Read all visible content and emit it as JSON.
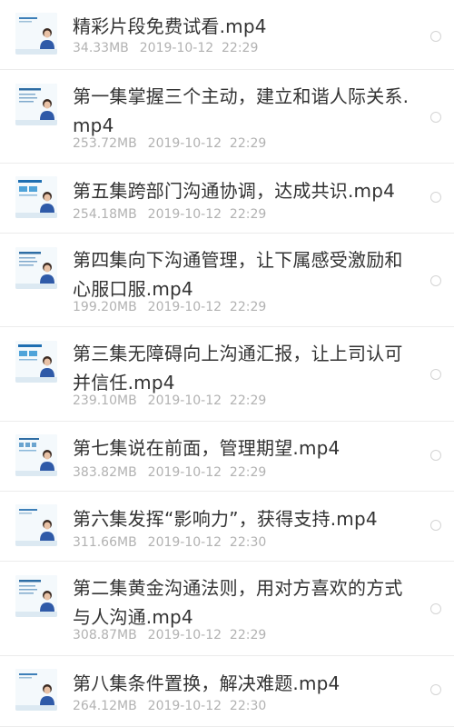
{
  "files": [
    {
      "name": "精彩片段免费试看.mp4",
      "size": "34.33MB",
      "date": "2019-10-12  22:29",
      "thumb_variant": "a"
    },
    {
      "name": "第一集掌握三个主动，建立和谐人际关系.mp4",
      "size": "253.72MB",
      "date": "2019-10-12  22:29",
      "thumb_variant": "b"
    },
    {
      "name": "第五集跨部门沟通协调，达成共识.mp4",
      "size": "254.18MB",
      "date": "2019-10-12  22:29",
      "thumb_variant": "c"
    },
    {
      "name": "第四集向下沟通管理，让下属感受激励和心服口服.mp4",
      "size": "199.20MB",
      "date": "2019-10-12  22:29",
      "thumb_variant": "b"
    },
    {
      "name": "第三集无障碍向上沟通汇报，让上司认可并信任.mp4",
      "size": "239.10MB",
      "date": "2019-10-12  22:29",
      "thumb_variant": "c"
    },
    {
      "name": "第七集说在前面，管理期望.mp4",
      "size": "383.82MB",
      "date": "2019-10-12  22:29",
      "thumb_variant": "d"
    },
    {
      "name": "第六集发挥“影响力”，获得支持.mp4",
      "size": "311.66MB",
      "date": "2019-10-12  22:30",
      "thumb_variant": "a"
    },
    {
      "name": "第二集黄金沟通法则，用对方喜欢的方式与人沟通.mp4",
      "size": "308.87MB",
      "date": "2019-10-12  22:29",
      "thumb_variant": "b"
    },
    {
      "name": "第八集条件置换，解决难题.mp4",
      "size": "264.12MB",
      "date": "2019-10-12  22:30",
      "thumb_variant": "a"
    }
  ],
  "colors": {
    "title_text": "#333333",
    "meta_text": "#b2b2b2",
    "divider": "#ececec",
    "radio_border": "#d4d4d4",
    "thumb_background": "#eef6fb"
  },
  "icons": {
    "thumbnail": "video-thumbnail-icon",
    "select": "radio-circle-icon"
  }
}
